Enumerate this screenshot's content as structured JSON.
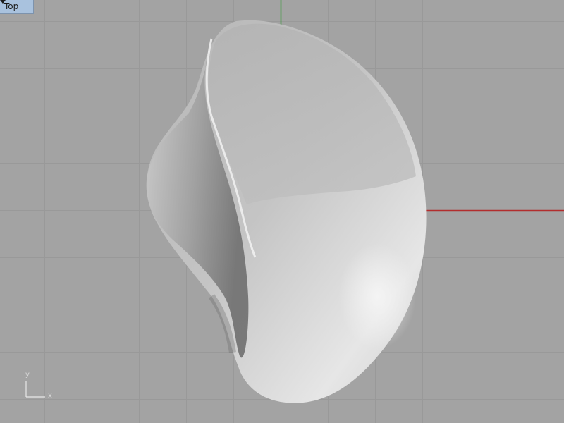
{
  "viewport": {
    "name": "Top",
    "menu_icon": "chevron-down-icon"
  },
  "axis_widget": {
    "x_label": "x",
    "y_label": "y"
  },
  "colors": {
    "background": "#a3a3a3",
    "grid_line": "#9a9a9a",
    "x_axis": "#b22d2d",
    "y_axis": "#2e9a2e",
    "tab_background": "#a9c2de",
    "shape_light": "#f4f4f4",
    "shape_shadow": "#6e6e6e"
  }
}
